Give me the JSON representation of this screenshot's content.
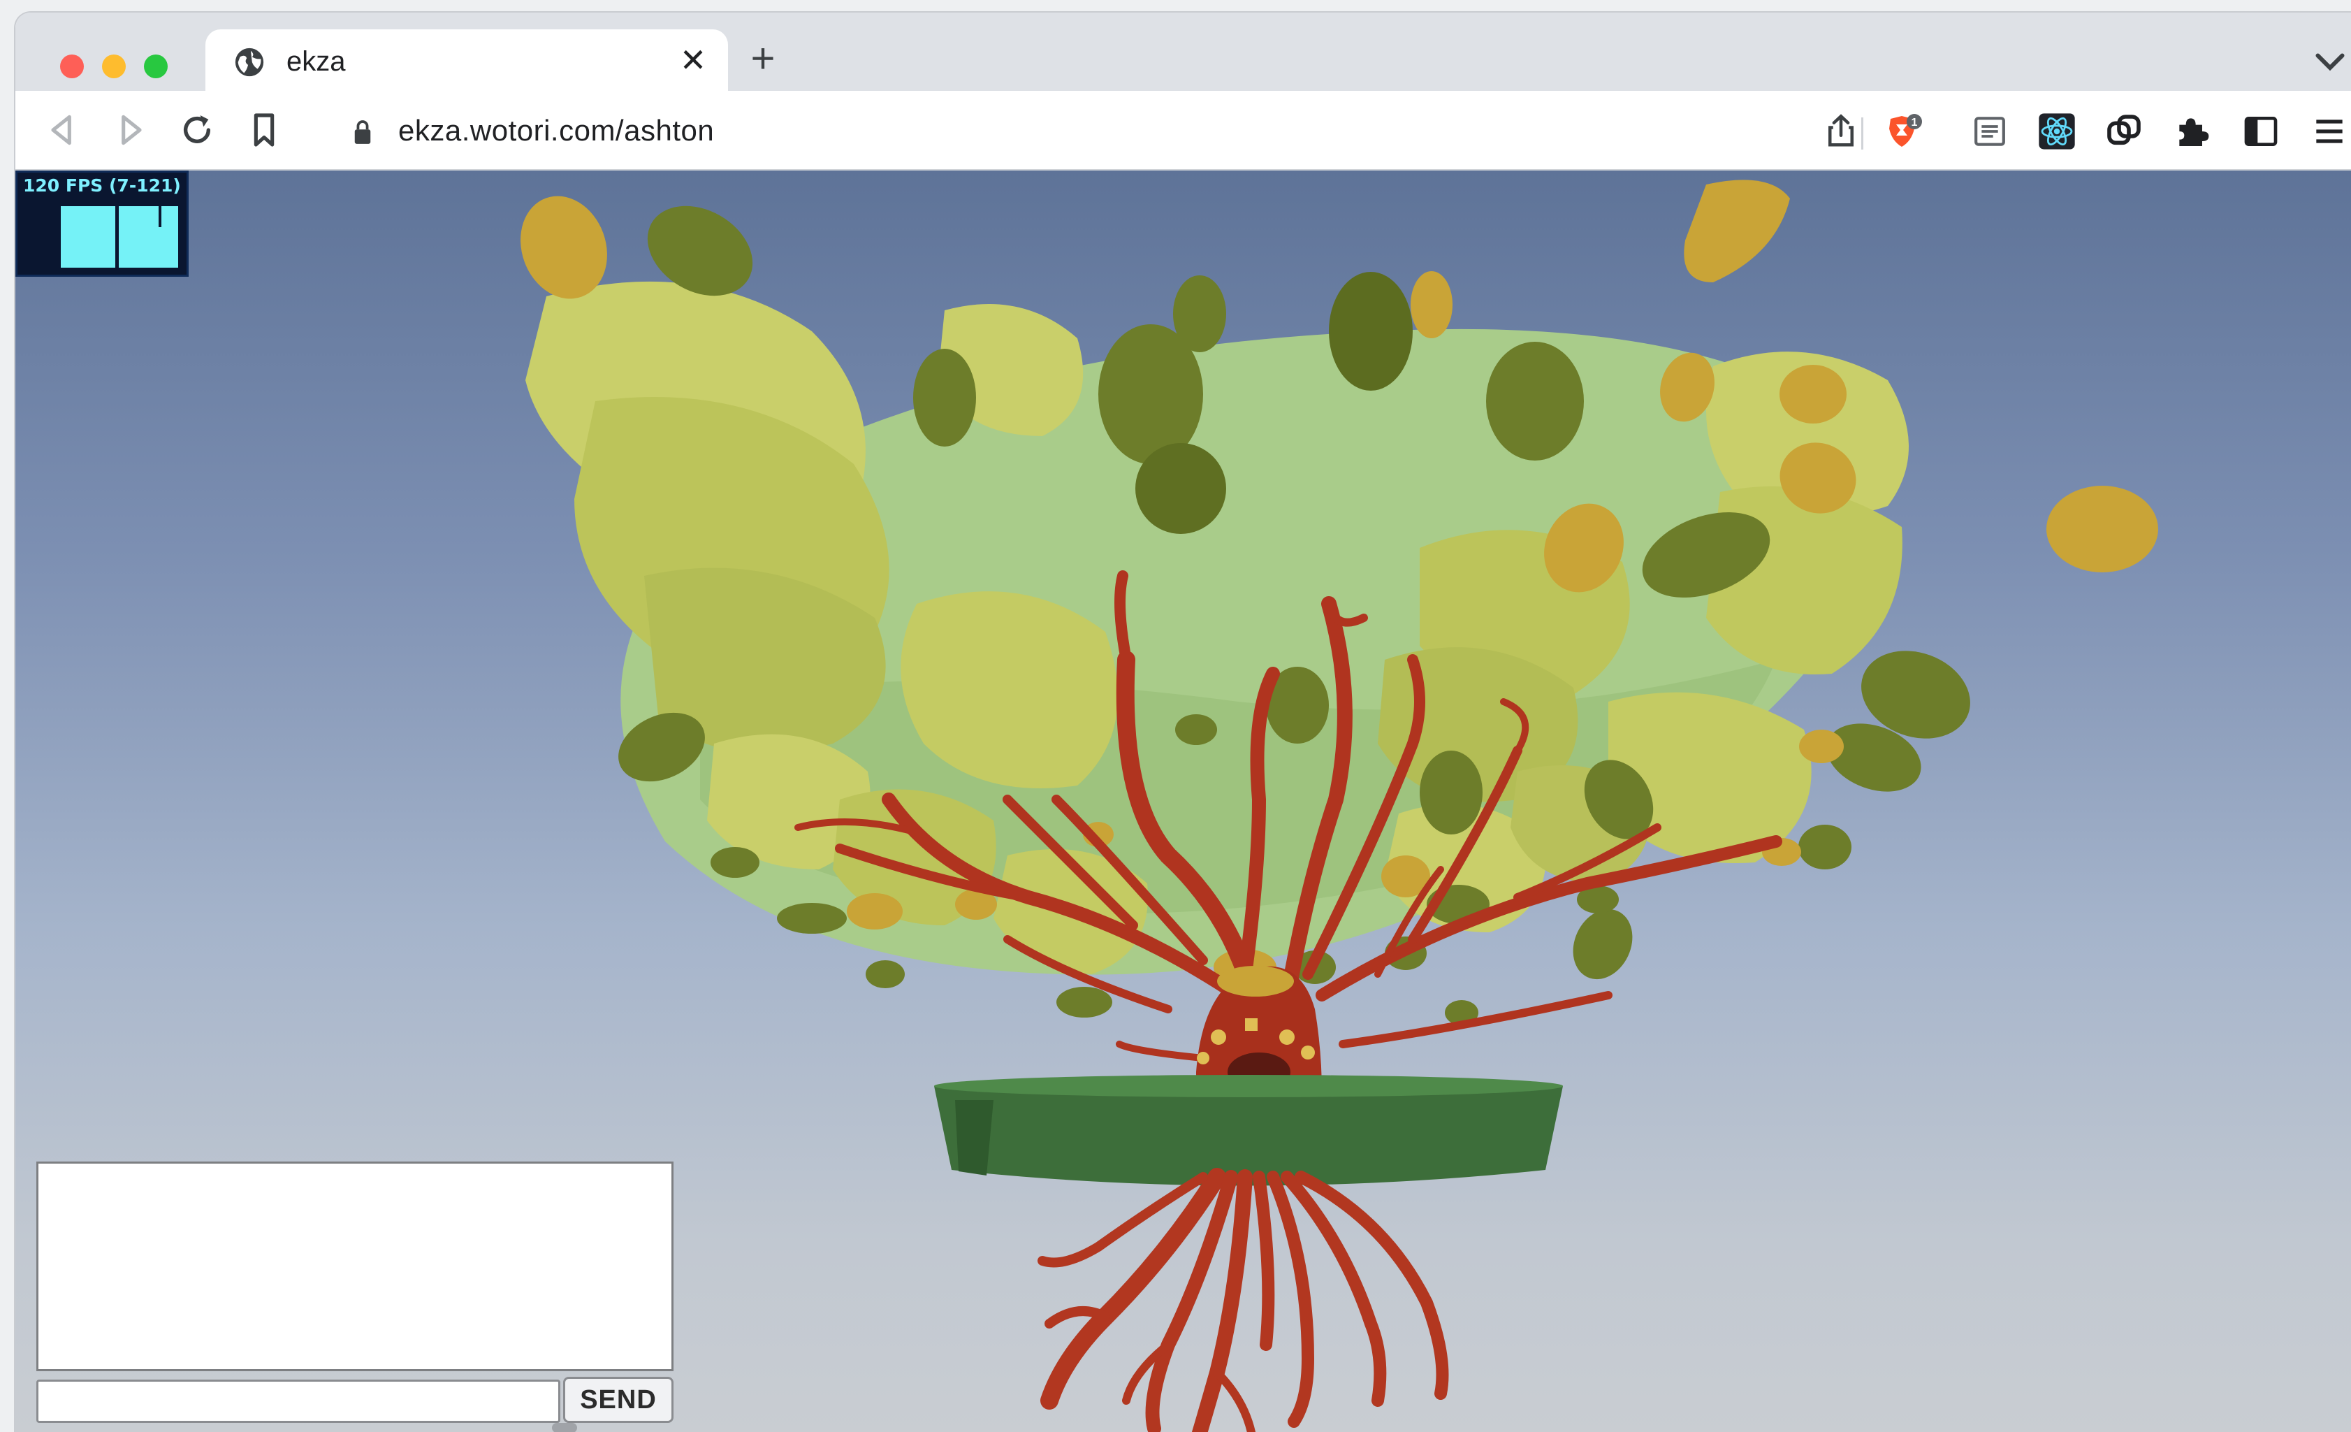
{
  "browser": {
    "tab_title": "ekza",
    "close_glyph": "✕",
    "new_tab_glyph": "+",
    "tab_menu_glyph": "⌄",
    "url": "ekza.wotori.com/ashton",
    "shield_badge": "1"
  },
  "icons": {
    "tab_favicon": "globe-icon",
    "back": "back-arrow-icon",
    "forward": "forward-arrow-icon",
    "reload": "reload-icon",
    "bookmark": "bookmark-icon",
    "lock": "lock-icon",
    "share": "share-icon",
    "brave_shield": "brave-shield-icon",
    "reader": "reader-mode-icon",
    "react_devtools": "react-devtools-icon",
    "wallet": "linked-rings-icon",
    "extensions": "puzzle-piece-icon",
    "sidebar": "sidebar-icon",
    "menu": "hamburger-menu-icon"
  },
  "stats": {
    "fps_label": "120 FPS (7-121)"
  },
  "chat": {
    "send_label": "SEND",
    "input_value": "",
    "log_text": ""
  },
  "colors": {
    "sky_top": "#5e7398",
    "sky_bottom": "#c9cdd2",
    "foliage_light": "#c9cf6a",
    "foliage_dark": "#6d7d2a",
    "branch_red": "#b0341f",
    "platform_green": "#3d6e3a",
    "fps_cyan": "#75f2f7"
  }
}
